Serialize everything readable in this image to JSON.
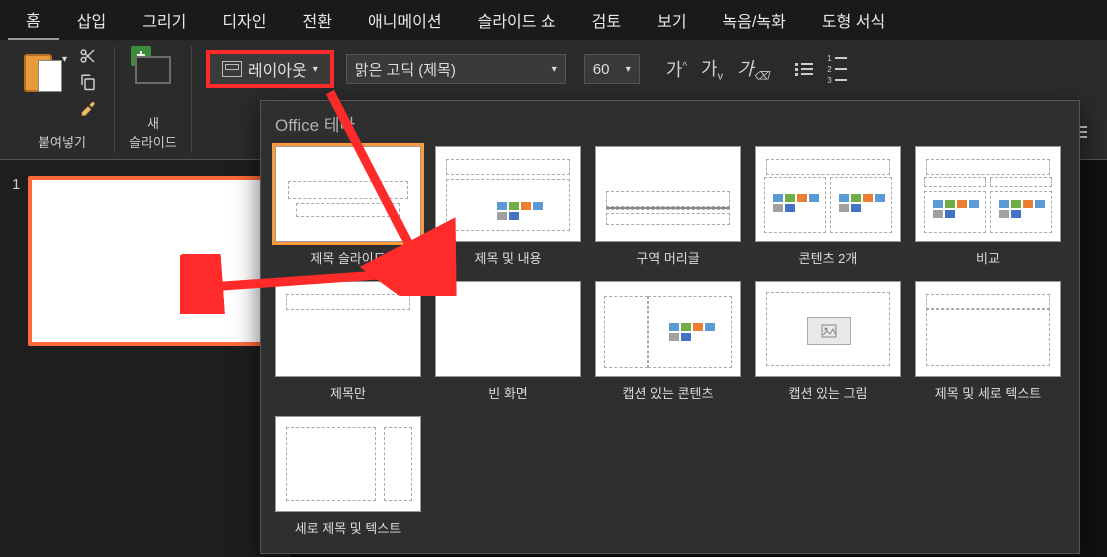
{
  "tabs": {
    "home": "홈",
    "insert": "삽입",
    "draw": "그리기",
    "design": "디자인",
    "transitions": "전환",
    "animations": "애니메이션",
    "slideshow": "슬라이드 쇼",
    "review": "검토",
    "view": "보기",
    "record": "녹음/녹화",
    "shape_format": "도형 서식"
  },
  "toolbar": {
    "paste_label": "붙여넣기",
    "new_slide_label": "새\n슬라이드",
    "layout_label": "레이아웃",
    "font_name": "맑은 고딕 (제목)",
    "font_size": "60"
  },
  "slide_rail": {
    "current_slide_number": "1"
  },
  "layout_panel": {
    "heading": "Office 테마",
    "items": [
      {
        "key": "title_slide",
        "label": "제목 슬라이드"
      },
      {
        "key": "title_content",
        "label": "제목 및 내용"
      },
      {
        "key": "section_header",
        "label": "구역 머리글"
      },
      {
        "key": "two_content",
        "label": "콘텐츠 2개"
      },
      {
        "key": "comparison",
        "label": "비교"
      },
      {
        "key": "title_only",
        "label": "제목만"
      },
      {
        "key": "blank",
        "label": "빈 화면"
      },
      {
        "key": "content_caption",
        "label": "캡션 있는 콘텐츠"
      },
      {
        "key": "picture_caption",
        "label": "캡션 있는 그림"
      },
      {
        "key": "title_vertical_text",
        "label": "제목 및 세로 텍스트"
      },
      {
        "key": "vertical_title_text",
        "label": "세로 제목 및 텍스트"
      }
    ]
  },
  "colors": {
    "highlight": "#ff2a2a",
    "selection": "#ff6a3a"
  }
}
